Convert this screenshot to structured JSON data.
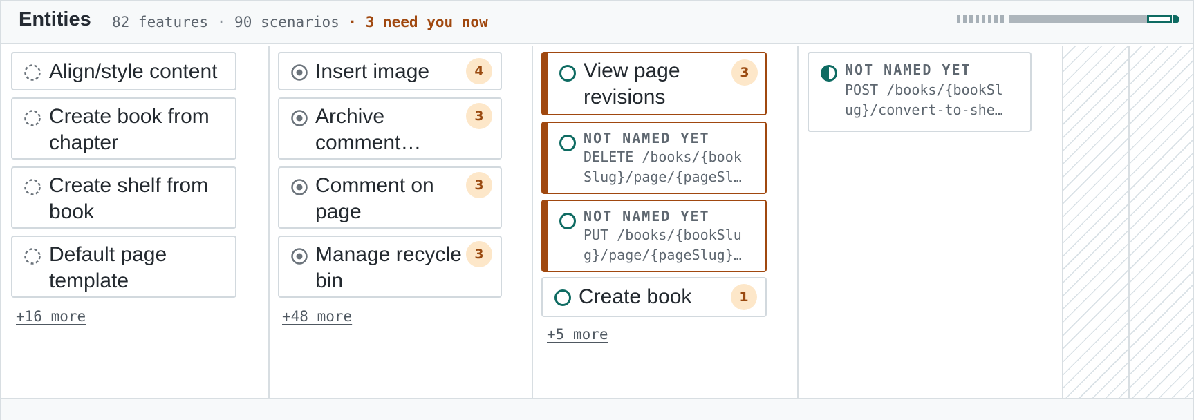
{
  "header": {
    "title": "Entities",
    "features": "82 features",
    "separator": "·",
    "scenarios": "90 scenarios",
    "urgent": "· 3 need you now"
  },
  "colors": {
    "accent": "#0e6b62",
    "urgent": "#a0480f",
    "badge_bg": "#fde7c9",
    "border": "#d8dee2"
  },
  "columns": [
    {
      "cards": [
        {
          "label": "Align/style content",
          "icon": "dashed-circle-icon"
        },
        {
          "label": "Create book from chapter",
          "icon": "dashed-circle-icon"
        },
        {
          "label": "Create shelf from book",
          "icon": "dashed-circle-icon"
        },
        {
          "label": "Default page template",
          "icon": "dashed-circle-icon"
        }
      ],
      "more": "+16 more"
    },
    {
      "cards": [
        {
          "label": "Insert image",
          "badge": "4",
          "icon": "dot-circle-icon"
        },
        {
          "label": "Archive comment…",
          "badge": "3",
          "icon": "dot-circle-icon"
        },
        {
          "label": "Comment on page",
          "badge": "3",
          "icon": "dot-circle-icon"
        },
        {
          "label": "Manage recycle bin",
          "badge": "3",
          "icon": "dot-circle-icon"
        }
      ],
      "more": "+48 more"
    },
    {
      "cards": [
        {
          "label": "View page revisions",
          "badge": "3",
          "icon": "open-circle-icon"
        },
        {
          "unnamed": "NOT NAMED YET",
          "route_l1": "DELETE /books/{book",
          "route_l2": "Slug}/page/{pageSl…",
          "icon": "open-circle-icon"
        },
        {
          "unnamed": "NOT NAMED YET",
          "route_l1": "PUT /books/{bookSlu",
          "route_l2": "g}/page/{pageSlug}…",
          "icon": "open-circle-icon"
        },
        {
          "label": "Create book",
          "badge": "1",
          "icon": "open-circle-icon"
        }
      ],
      "more": "+5 more"
    },
    {
      "cards": [
        {
          "unnamed": "NOT NAMED YET",
          "route_l1": "POST /books/{bookSl",
          "route_l2": "ug}/convert-to-she…",
          "icon": "half-circle-icon"
        }
      ]
    }
  ],
  "progress": {
    "completed_fraction": 0.86
  }
}
